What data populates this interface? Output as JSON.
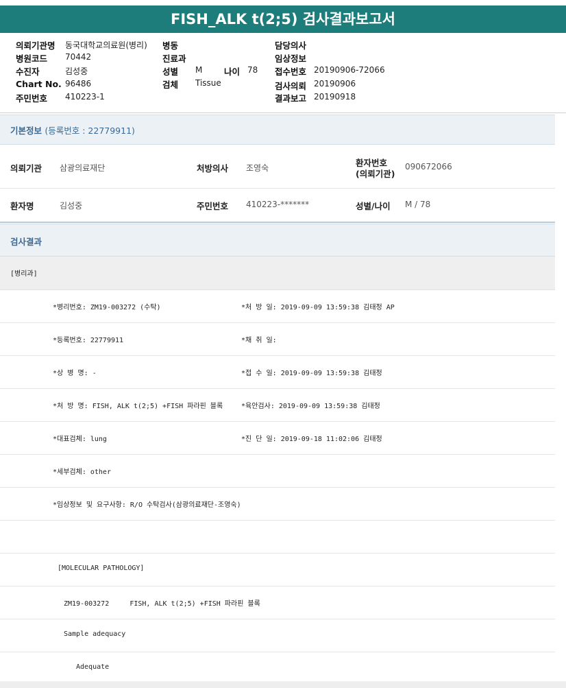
{
  "title": "FISH_ALK t(2;5) 검사결과보고서",
  "header": {
    "col1": [
      {
        "label": "의뢰기관명",
        "value": "동국대학교의료원(병리)"
      },
      {
        "label": "병원코드",
        "value": "70442"
      },
      {
        "label": "수진자",
        "value": "김성중"
      },
      {
        "label": "Chart No.",
        "value": "96486"
      },
      {
        "label": "주민번호",
        "value": "410223-1"
      }
    ],
    "col2": [
      {
        "label": "병동",
        "value": ""
      },
      {
        "label": "진료과",
        "value": ""
      },
      {
        "label": "성별",
        "value": "M"
      },
      {
        "label": "검체",
        "value": "Tissue"
      }
    ],
    "age": {
      "label": "나이",
      "value": "78"
    },
    "col3": [
      {
        "label": "담당의사",
        "value": ""
      },
      {
        "label": "임상정보",
        "value": ""
      },
      {
        "label": "접수번호",
        "value": "20190906-72066"
      },
      {
        "label": "검사의뢰",
        "value": "20190906"
      },
      {
        "label": "결과보고",
        "value": "20190918"
      }
    ]
  },
  "basic": {
    "title": "기본정보",
    "sub": "(등록번호 : 22779911)",
    "row1": {
      "inst_label": "의뢰기관",
      "inst_value": "삼광의료재단",
      "doc_label": "처방의사",
      "doc_value": "조영숙",
      "pno_label1": "환자번호",
      "pno_label2": "(의뢰기관)",
      "pno_value": "090672066"
    },
    "row2": {
      "name_label": "환자명",
      "name_value": "김성중",
      "rrn_label": "주민번호",
      "rrn_value": "410223-*******",
      "sa_label": "성별/나이",
      "sa_value": "M / 78"
    }
  },
  "result": {
    "title": "검사결과",
    "dept": "[병리과]",
    "rows": [
      {
        "left": "*병리번호: ZM19-003272 (수탁)",
        "right": "*처 방 일: 2019-09-09 13:59:38  김태정 AP"
      },
      {
        "left": "*등록번호: 22779911",
        "right": "*채 취 일:"
      },
      {
        "left": "*상 병 명: -",
        "right": "*접 수 일: 2019-09-09 13:59:38  김태정"
      },
      {
        "left": "*처 방 명: FISH, ALK t(2;5) +FISH 파라핀 블록",
        "right": "*육안검사: 2019-09-09 13:59:38  김태정"
      },
      {
        "left": "*대표검체: lung",
        "right": "*진 단 일: 2019-09-18 11:02:06  김태정"
      },
      {
        "left": "*세부검체: other",
        "right": ""
      },
      {
        "left": "*임상정보 및 요구사항: R/O 수탁검사(삼광의료재단-조영숙)",
        "right": ""
      },
      {
        "left": "",
        "right": ""
      }
    ],
    "mol_header": "[MOLECULAR PATHOLOGY]",
    "mol_line": "ZM19-003272     FISH, ALK t(2;5) +FISH 파라핀 블록",
    "sample_label": "Sample adequacy",
    "sample_value": "Adequate"
  }
}
